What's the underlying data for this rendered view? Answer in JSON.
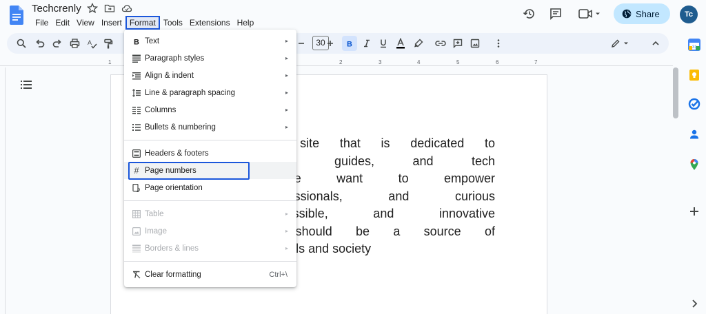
{
  "app": {
    "title": "Techcrenly",
    "menus": [
      "File",
      "Edit",
      "View",
      "Insert",
      "Format",
      "Tools",
      "Extensions",
      "Help"
    ],
    "active_menu": "Format",
    "share_label": "Share",
    "avatar_initials": "Tc"
  },
  "toolbar": {
    "font_size": "30"
  },
  "ruler": {
    "ticks": [
      "1",
      "1",
      "2",
      "3",
      "4",
      "5",
      "6",
      "7"
    ]
  },
  "document": {
    "lines": [
      "a tech blog site that is dedicated to",
      "rticles,  how-to  guides,  and  tech",
      "technology. We want to empower",
      "siasts,  professionals,  and  curious",
      "luable,  accessible,  and  innovative",
      "t technology should be a source of",
      "change for individuals and society"
    ]
  },
  "format_menu": {
    "groups": [
      [
        {
          "label": "Text",
          "icon": "bold-icon",
          "submenu": true
        },
        {
          "label": "Paragraph styles",
          "icon": "paragraph-styles-icon",
          "submenu": true
        },
        {
          "label": "Align & indent",
          "icon": "align-icon",
          "submenu": true
        },
        {
          "label": "Line & paragraph spacing",
          "icon": "line-spacing-icon",
          "submenu": true
        },
        {
          "label": "Columns",
          "icon": "columns-icon",
          "submenu": true
        },
        {
          "label": "Bullets & numbering",
          "icon": "bullets-icon",
          "submenu": true
        }
      ],
      [
        {
          "label": "Headers & footers",
          "icon": "headers-footers-icon",
          "submenu": false
        },
        {
          "label": "Page numbers",
          "icon": "hash-icon",
          "submenu": false,
          "highlighted": true
        },
        {
          "label": "Page orientation",
          "icon": "page-orientation-icon",
          "submenu": false
        }
      ],
      [
        {
          "label": "Table",
          "icon": "table-icon",
          "submenu": true,
          "disabled": true
        },
        {
          "label": "Image",
          "icon": "image-icon",
          "submenu": true,
          "disabled": true
        },
        {
          "label": "Borders & lines",
          "icon": "borders-icon",
          "submenu": true,
          "disabled": true
        }
      ],
      [
        {
          "label": "Clear formatting",
          "icon": "clear-formatting-icon",
          "submenu": false,
          "shortcut": "Ctrl+\\"
        }
      ]
    ]
  },
  "colors": {
    "accent": "#1a56db",
    "share_bg": "#c2e7ff",
    "toolbar_bg": "#edf2fa"
  }
}
